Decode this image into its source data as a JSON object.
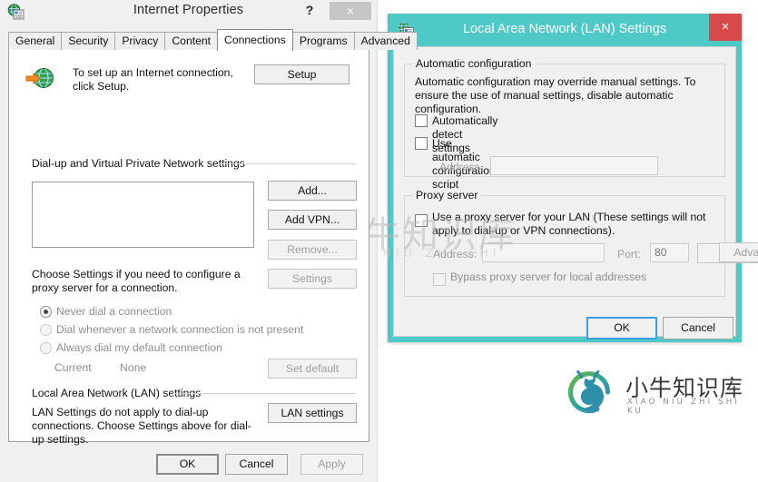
{
  "internet_properties": {
    "title": "Internet Properties",
    "icon": "internet-properties-icon",
    "help_glyph": "?",
    "close_glyph": "×",
    "tabs": [
      {
        "label": "General",
        "active": false
      },
      {
        "label": "Security",
        "active": false
      },
      {
        "label": "Privacy",
        "active": false
      },
      {
        "label": "Content",
        "active": false
      },
      {
        "label": "Connections",
        "active": true
      },
      {
        "label": "Programs",
        "active": false
      },
      {
        "label": "Advanced",
        "active": false
      }
    ],
    "setup": {
      "text": "To set up an Internet connection, click Setup.",
      "button": "Setup"
    },
    "dialup_group": {
      "label": "Dial-up and Virtual Private Network settings",
      "buttons": [
        {
          "label": "Add...",
          "enabled": true
        },
        {
          "label": "Add VPN...",
          "enabled": true
        },
        {
          "label": "Remove...",
          "enabled": false
        },
        {
          "label": "Settings",
          "enabled": false
        }
      ],
      "list_items": []
    },
    "proxy_hint": "Choose Settings if you need to configure a proxy server for a connection.",
    "dial_options": [
      {
        "label": "Never dial a connection",
        "selected": true,
        "enabled": false
      },
      {
        "label": "Dial whenever a network connection is not present",
        "selected": false,
        "enabled": false
      },
      {
        "label": "Always dial my default connection",
        "selected": false,
        "enabled": false
      }
    ],
    "current_label": "Current",
    "current_value": "None",
    "set_default_button": "Set default",
    "lan_group": {
      "label": "Local Area Network (LAN) settings",
      "text": "LAN Settings do not apply to dial-up connections. Choose Settings above for dial-up settings.",
      "button": "LAN settings"
    },
    "footer": [
      {
        "label": "OK",
        "enabled": true,
        "focused": true
      },
      {
        "label": "Cancel",
        "enabled": true,
        "focused": false
      },
      {
        "label": "Apply",
        "enabled": false,
        "focused": false
      }
    ]
  },
  "lan_settings": {
    "title": "Local Area Network (LAN) Settings",
    "icon": "lan-settings-icon",
    "close_glyph": "×",
    "titlebar_color": "#4fc8c8",
    "close_color": "#d84a4a",
    "auto_config": {
      "label": "Automatic configuration",
      "description": "Automatic configuration may override manual settings.  To ensure the use of manual settings, disable automatic configuration.",
      "checkbox_detect": {
        "label": "Automatically detect settings",
        "checked": false,
        "enabled": true
      },
      "checkbox_script": {
        "label": "Use automatic configuration script",
        "checked": false,
        "enabled": true
      },
      "address_label": "Address",
      "address_value": "",
      "address_enabled": false
    },
    "proxy_server": {
      "label": "Proxy server",
      "checkbox_use_proxy": {
        "label": "Use a proxy server for your LAN (These settings will not apply to dial-up or VPN connections).",
        "checked": false,
        "enabled": true
      },
      "address_label": "Address:",
      "address_value": "",
      "port_label": "Port:",
      "port_value": "80",
      "advanced_button": {
        "label": "Advanced",
        "enabled": false
      },
      "checkbox_bypass": {
        "label": "Bypass proxy server for local addresses",
        "checked": false,
        "enabled": false
      }
    },
    "footer": [
      {
        "label": "OK",
        "enabled": true,
        "focused": true
      },
      {
        "label": "Cancel",
        "enabled": true,
        "focused": false
      }
    ]
  },
  "watermarks": {
    "logo_name": "xiaoniu-logo",
    "text_cn": "小牛知识库",
    "text_pinyin": "XIAO NIU ZHI SHI KU"
  }
}
